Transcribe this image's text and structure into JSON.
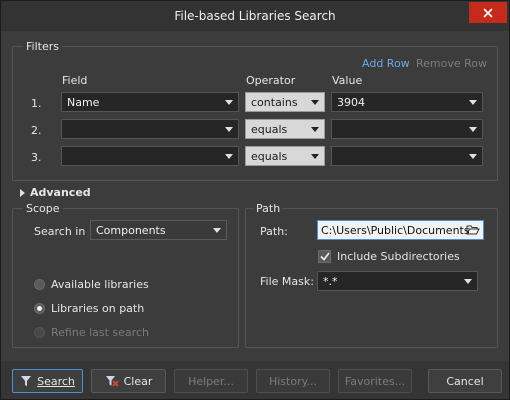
{
  "window": {
    "title": "File-based Libraries Search"
  },
  "filters": {
    "label": "Filters",
    "add_row": "Add Row",
    "remove_row": "Remove Row",
    "headers": {
      "field": "Field",
      "operator": "Operator",
      "value": "Value"
    },
    "rows": [
      {
        "num": "1.",
        "field": "Name",
        "operator": "contains",
        "value": "3904"
      },
      {
        "num": "2.",
        "field": "",
        "operator": "equals",
        "value": ""
      },
      {
        "num": "3.",
        "field": "",
        "operator": "equals",
        "value": ""
      }
    ]
  },
  "advanced": {
    "label": "Advanced"
  },
  "scope": {
    "label": "Scope",
    "search_in_label": "Search in",
    "search_in_value": "Components",
    "options": [
      {
        "label": "Available libraries",
        "selected": false,
        "enabled": true
      },
      {
        "label": "Libraries on path",
        "selected": true,
        "enabled": true
      },
      {
        "label": "Refine last search",
        "selected": false,
        "enabled": false
      }
    ]
  },
  "path": {
    "label": "Path",
    "path_label": "Path:",
    "path_value": "C:\\Users\\Public\\Documents",
    "include_subdirs_label": "Include Subdirectories",
    "include_subdirs_checked": true,
    "file_mask_label": "File Mask:",
    "file_mask_value": "*.*"
  },
  "footer": {
    "search": "Search",
    "clear": "Clear",
    "helper": "Helper...",
    "history": "History...",
    "favorites": "Favorites...",
    "cancel": "Cancel"
  },
  "colors": {
    "accent": "#4b8fd9",
    "link": "#6fa8e8",
    "close": "#c42b1c"
  }
}
